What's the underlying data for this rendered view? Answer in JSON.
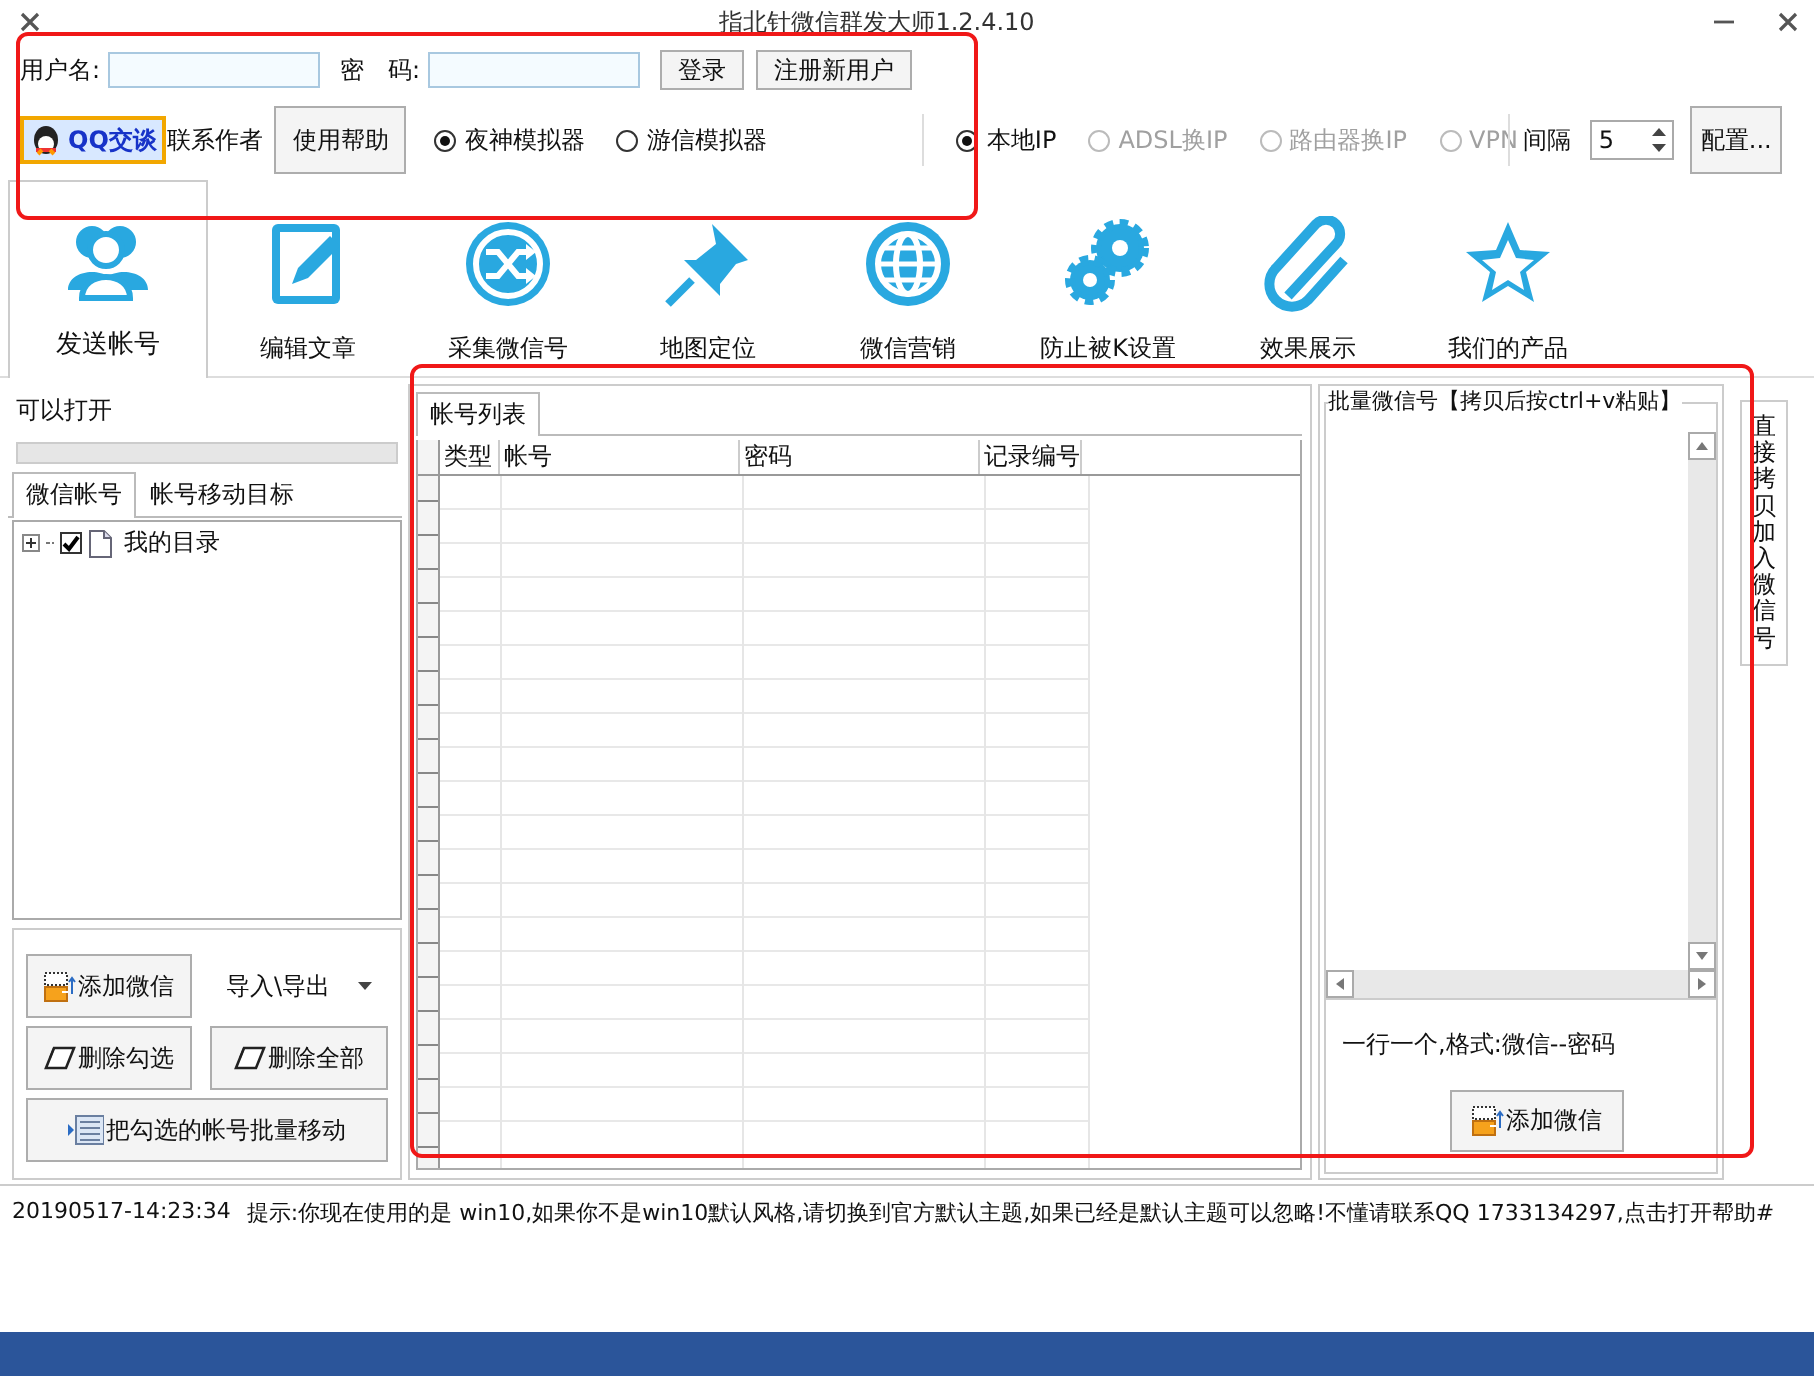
{
  "window": {
    "title": "指北针微信群发大师1.2.4.10"
  },
  "login": {
    "username_label": "用户名:",
    "password_label": "密　码:",
    "buttons": [
      "登录",
      "注册新用户"
    ]
  },
  "toolbar": {
    "qq_button": "QQ交谈",
    "contact_label": "联系作者",
    "help_button": "使用帮助",
    "emulators": [
      {
        "label": "夜神模拟器",
        "selected": true
      },
      {
        "label": "游信模拟器",
        "selected": false
      }
    ],
    "ip_modes": [
      {
        "label": "本地IP",
        "selected": true,
        "disabled": false
      },
      {
        "label": "ADSL换IP",
        "selected": false,
        "disabled": true
      },
      {
        "label": "路由器换IP",
        "selected": false,
        "disabled": true
      },
      {
        "label": "VPN",
        "selected": false,
        "disabled": true
      }
    ],
    "interval_label": "间隔",
    "interval_value": "5",
    "config_button": "配置..."
  },
  "nav_tabs": [
    {
      "label": "发送帐号",
      "kind": "users",
      "selected": true
    },
    {
      "label": "编辑文章",
      "kind": "edit",
      "selected": false
    },
    {
      "label": "采集微信号",
      "kind": "shuffle",
      "selected": false
    },
    {
      "label": "地图定位",
      "kind": "pin",
      "selected": false
    },
    {
      "label": "微信营销",
      "kind": "globe",
      "selected": false
    },
    {
      "label": "防止被K设置",
      "kind": "gears",
      "selected": false
    },
    {
      "label": "效果展示",
      "kind": "clip",
      "selected": false
    },
    {
      "label": "我们的产品",
      "kind": "star",
      "selected": false
    }
  ],
  "left_panel": {
    "status_text": "可以打开",
    "progress": {
      "level": 0
    },
    "tabs": [
      {
        "label": "微信帐号",
        "selected": true
      },
      {
        "label": "帐号移动目标",
        "selected": false
      }
    ],
    "tree": [
      {
        "label": "我的目录",
        "checked": true,
        "expanded": false
      }
    ],
    "buttons": [
      {
        "label": "添加微信",
        "kind": "add"
      },
      {
        "label": "导入\\导出",
        "kind": "dropdown"
      },
      {
        "label": "删除勾选",
        "kind": "erase"
      },
      {
        "label": "删除全部",
        "kind": "erase"
      },
      {
        "label": "把勾选的帐号批量移动",
        "kind": "move"
      }
    ]
  },
  "center_panel": {
    "tab": {
      "label": "帐号列表",
      "selected": true
    },
    "columns": [
      "类型",
      "帐号",
      "密码",
      "记录编号"
    ]
  },
  "right_panel": {
    "group_title": "批量微信号【拷贝后按ctrl+v粘贴】",
    "hint": "一行一个,格式:微信--密码",
    "add_button": "添加微信"
  },
  "side_tab": {
    "label": "直接拷贝加入微信号"
  },
  "log": {
    "time": "20190517-14:23:34",
    "message": "提示:你现在使用的是 win10,如果你不是win10默认风格,请切换到官方默认主题,如果已经是默认主题可以忽略!不懂请联系QQ 1733134297,点击打开帮助#"
  }
}
